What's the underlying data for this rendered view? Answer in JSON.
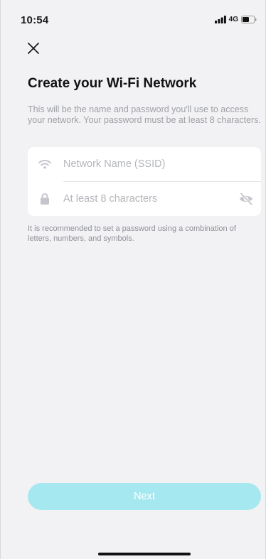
{
  "status_bar": {
    "time": "10:54",
    "network_type": "4G"
  },
  "page": {
    "title": "Create your Wi-Fi Network",
    "description": "This will be the name and password you'll use to access your network. Your password must be at least 8 characters.",
    "hint": "It is recommended to set a password using a combination of letters, numbers, and symbols."
  },
  "form": {
    "ssid": {
      "placeholder": "Network Name (SSID)",
      "value": "",
      "icon": "wifi-icon"
    },
    "password": {
      "placeholder": "At least 8 characters",
      "value": "",
      "icon": "lock-icon",
      "visibility_icon": "eye-off-icon"
    }
  },
  "actions": {
    "next_label": "Next"
  },
  "colors": {
    "accent_disabled": "#a6e8f0",
    "background": "#f2f2f4",
    "card": "#ffffff",
    "muted_text": "#9ea0a6"
  }
}
